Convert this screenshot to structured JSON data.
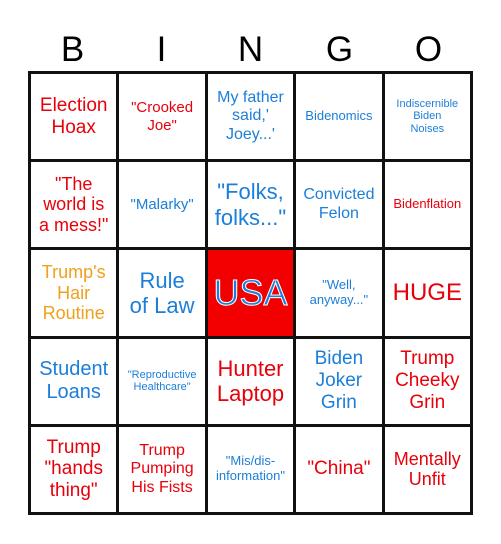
{
  "header": {
    "letters": [
      "B",
      "I",
      "N",
      "G",
      "O"
    ]
  },
  "colors": {
    "red": "#e8000b",
    "blue": "#1b7fd9",
    "orange": "#f0a01c",
    "free_space_fill": "#f20000"
  },
  "board": {
    "rows": [
      [
        {
          "text": "Election\nHoax",
          "color": "red"
        },
        {
          "text": "\"Crooked\nJoe\"",
          "color": "red"
        },
        {
          "text": "My father\nsaid,'\nJoey...'",
          "color": "blue"
        },
        {
          "text": "Bidenomics",
          "color": "blue"
        },
        {
          "text": "Indiscernible\nBiden\nNoises",
          "color": "blue"
        }
      ],
      [
        {
          "text": "\"The\nworld is\na mess!\"",
          "color": "red"
        },
        {
          "text": "\"Malarky\"",
          "color": "blue"
        },
        {
          "text": "\"Folks,\nfolks...\"",
          "color": "blue"
        },
        {
          "text": "Convicted\nFelon",
          "color": "blue"
        },
        {
          "text": "Bidenflation",
          "color": "red"
        }
      ],
      [
        {
          "text": "Trump's\nHair\nRoutine",
          "color": "orange"
        },
        {
          "text": "Rule\nof Law",
          "color": "blue"
        },
        {
          "text": "USA",
          "color": "blue",
          "free_space": true
        },
        {
          "text": "\"Well,\nanyway...\"",
          "color": "blue"
        },
        {
          "text": "HUGE",
          "color": "red"
        }
      ],
      [
        {
          "text": "Student\nLoans",
          "color": "blue"
        },
        {
          "text": "\"Reproductive\nHealthcare\"",
          "color": "blue"
        },
        {
          "text": "Hunter\nLaptop",
          "color": "red"
        },
        {
          "text": "Biden\nJoker\nGrin",
          "color": "blue"
        },
        {
          "text": "Trump\nCheeky\nGrin",
          "color": "red"
        }
      ],
      [
        {
          "text": "Trump\n\"hands\nthing\"",
          "color": "red"
        },
        {
          "text": "Trump\nPumping\nHis Fists",
          "color": "red"
        },
        {
          "text": "\"Mis/dis-\ninformation\"",
          "color": "blue"
        },
        {
          "text": "\"China\"",
          "color": "red"
        },
        {
          "text": "Mentally\nUnfit",
          "color": "red"
        }
      ]
    ]
  }
}
